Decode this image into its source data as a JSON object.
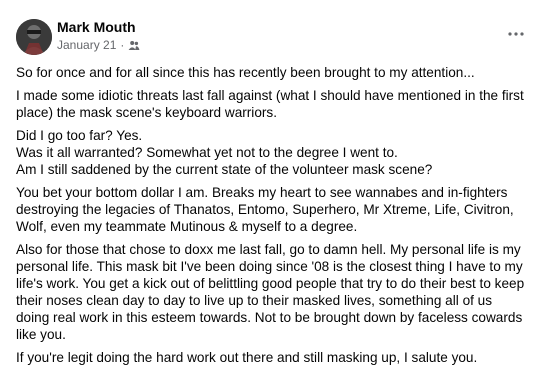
{
  "post": {
    "author": "Mark Mouth",
    "date": "January 21",
    "separator": "·",
    "audience_icon": "friends-icon",
    "more_icon": "more-horizontal-icon",
    "paragraphs": [
      "So for once and for all since this has recently been brought to my attention...",
      "I made some idiotic threats last fall against (what I should have mentioned in the first place) the mask scene's keyboard warriors.",
      "Did I go too far? Yes.\nWas it all warranted? Somewhat yet not to the degree I went to.\nAm I still saddened by the current state of the volunteer mask scene?",
      "You bet your bottom dollar I am. Breaks my heart to see wannabes and in-fighters destroying the legacies of Thanatos, Entomo, Superhero, Mr Xtreme, Life, Civitron, Wolf, even my teammate Mutinous & myself to a degree.",
      "Also for those that chose to doxx me last fall, go to damn hell. My personal life is my personal life. This mask bit I've been doing since '08 is the closest thing I have to my life's work. You get a kick out of belittling good people that try to do their best to keep their noses clean day to day to live up to their masked lives, something all of us doing real work in this esteem towards. Not to be brought down by faceless cowards like you.",
      "If you're legit doing the hard work out there and still masking up, I salute you."
    ]
  }
}
